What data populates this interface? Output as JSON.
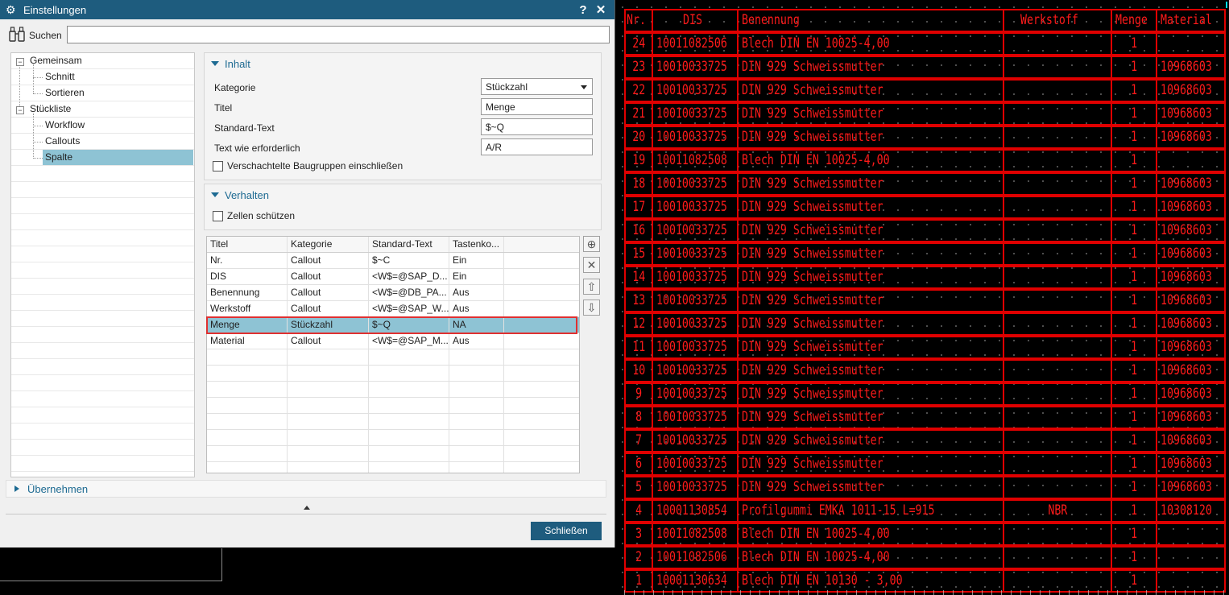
{
  "dialog": {
    "title": "Einstellungen",
    "help_label": "?",
    "close_label": "✕",
    "search_label": "Suchen",
    "search_value": "",
    "tree": [
      {
        "label": "Gemeinsam",
        "level": 0,
        "expanded": true
      },
      {
        "label": "Schnitt",
        "level": 1
      },
      {
        "label": "Sortieren",
        "level": 1
      },
      {
        "label": "Stückliste",
        "level": 0,
        "expanded": true
      },
      {
        "label": "Workflow",
        "level": 1
      },
      {
        "label": "Callouts",
        "level": 1
      },
      {
        "label": "Spalte",
        "level": 1,
        "selected": true
      }
    ],
    "inhalt": {
      "header": "Inhalt",
      "kategorie_label": "Kategorie",
      "kategorie_value": "Stückzahl",
      "titel_label": "Titel",
      "titel_value": "Menge",
      "standard_label": "Standard-Text",
      "standard_value": "$~Q",
      "erforderlich_label": "Text wie erforderlich",
      "erforderlich_value": "A/R",
      "nested_label": "Verschachtelte Baugruppen einschließen",
      "nested_checked": false
    },
    "verhalten": {
      "header": "Verhalten",
      "protect_label": "Zellen schützen",
      "protect_checked": false
    },
    "grid": {
      "columns": [
        "Titel",
        "Kategorie",
        "Standard-Text",
        "Tastenko..."
      ],
      "rows": [
        [
          "Nr.",
          "Callout",
          "$~C",
          "Ein"
        ],
        [
          "DIS",
          "Callout",
          "<W$=@SAP_D...",
          "Ein"
        ],
        [
          "Benennung",
          "Callout",
          "<W$=@DB_PA...",
          "Aus"
        ],
        [
          "Werkstoff",
          "Callout",
          "<W$=@SAP_W...",
          "Aus"
        ],
        [
          "Menge",
          "Stückzahl",
          "$~Q",
          "NA"
        ],
        [
          "Material",
          "Callout",
          "<W$=@SAP_M...",
          "Aus"
        ]
      ],
      "selected_row": 4
    },
    "apply_label": "Übernehmen",
    "close_button_label": "Schließen"
  },
  "bom": {
    "headers": [
      "Nr.",
      "DIS",
      "Benennung",
      "Werkstoff",
      "Menge",
      "Material"
    ],
    "rows": [
      [
        "24",
        "10011082506",
        "Blech DIN EN 10025-4,00",
        "",
        "1",
        ""
      ],
      [
        "23",
        "10010033725",
        "DIN 929 Schweissmutter",
        "",
        "1",
        "10968603"
      ],
      [
        "22",
        "10010033725",
        "DIN 929 Schweissmutter",
        "",
        "1",
        "10968603"
      ],
      [
        "21",
        "10010033725",
        "DIN 929 Schweissmutter",
        "",
        "1",
        "10968603"
      ],
      [
        "20",
        "10010033725",
        "DIN 929 Schweissmutter",
        "",
        "1",
        "10968603"
      ],
      [
        "19",
        "10011082508",
        "Blech DIN EN 10025-4,00",
        "",
        "1",
        ""
      ],
      [
        "18",
        "10010033725",
        "DIN 929 Schweissmutter",
        "",
        "1",
        "10968603"
      ],
      [
        "17",
        "10010033725",
        "DIN 929 Schweissmutter",
        "",
        "1",
        "10968603"
      ],
      [
        "16",
        "10010033725",
        "DIN 929 Schweissmutter",
        "",
        "1",
        "10968603"
      ],
      [
        "15",
        "10010033725",
        "DIN 929 Schweissmutter",
        "",
        "1",
        "10968603"
      ],
      [
        "14",
        "10010033725",
        "DIN 929 Schweissmutter",
        "",
        "1",
        "10968603"
      ],
      [
        "13",
        "10010033725",
        "DIN 929 Schweissmutter",
        "",
        "1",
        "10968603"
      ],
      [
        "12",
        "10010033725",
        "DIN 929 Schweissmutter",
        "",
        "1",
        "10968603"
      ],
      [
        "11",
        "10010033725",
        "DIN 929 Schweissmutter",
        "",
        "1",
        "10968603"
      ],
      [
        "10",
        "10010033725",
        "DIN 929 Schweissmutter",
        "",
        "1",
        "10968603"
      ],
      [
        "9",
        "10010033725",
        "DIN 929 Schweissmutter",
        "",
        "1",
        "10968603"
      ],
      [
        "8",
        "10010033725",
        "DIN 929 Schweissmutter",
        "",
        "1",
        "10968603"
      ],
      [
        "7",
        "10010033725",
        "DIN 929 Schweissmutter",
        "",
        "1",
        "10968603"
      ],
      [
        "6",
        "10010033725",
        "DIN 929 Schweissmutter",
        "",
        "1",
        "10968603"
      ],
      [
        "5",
        "10010033725",
        "DIN 929 Schweissmutter",
        "",
        "1",
        "10968603"
      ],
      [
        "4",
        "10001130854",
        "Profilgummi EMKA 1011-15 L=915",
        "NBR",
        "1",
        "10308120"
      ],
      [
        "3",
        "10011082508",
        "Blech DIN EN 10025-4,00",
        "",
        "1",
        ""
      ],
      [
        "2",
        "10011082506",
        "Blech DIN EN 10025-4,00",
        "",
        "1",
        ""
      ],
      [
        "1",
        "10001130634",
        "Blech DIN EN 10130 - 3,00",
        "",
        "1",
        ""
      ]
    ]
  },
  "colors": {
    "accent": "#1e5c7e",
    "selection": "#8ec3d4",
    "highlight_outline": "#e03030",
    "cad_line": "#ff1a1a",
    "cad_background": "#000000"
  },
  "icons": [
    "gear-icon",
    "help-icon",
    "close-icon",
    "binoculars-icon",
    "add-icon",
    "delete-icon",
    "move-up-icon",
    "move-down-icon",
    "collapse-icon"
  ]
}
